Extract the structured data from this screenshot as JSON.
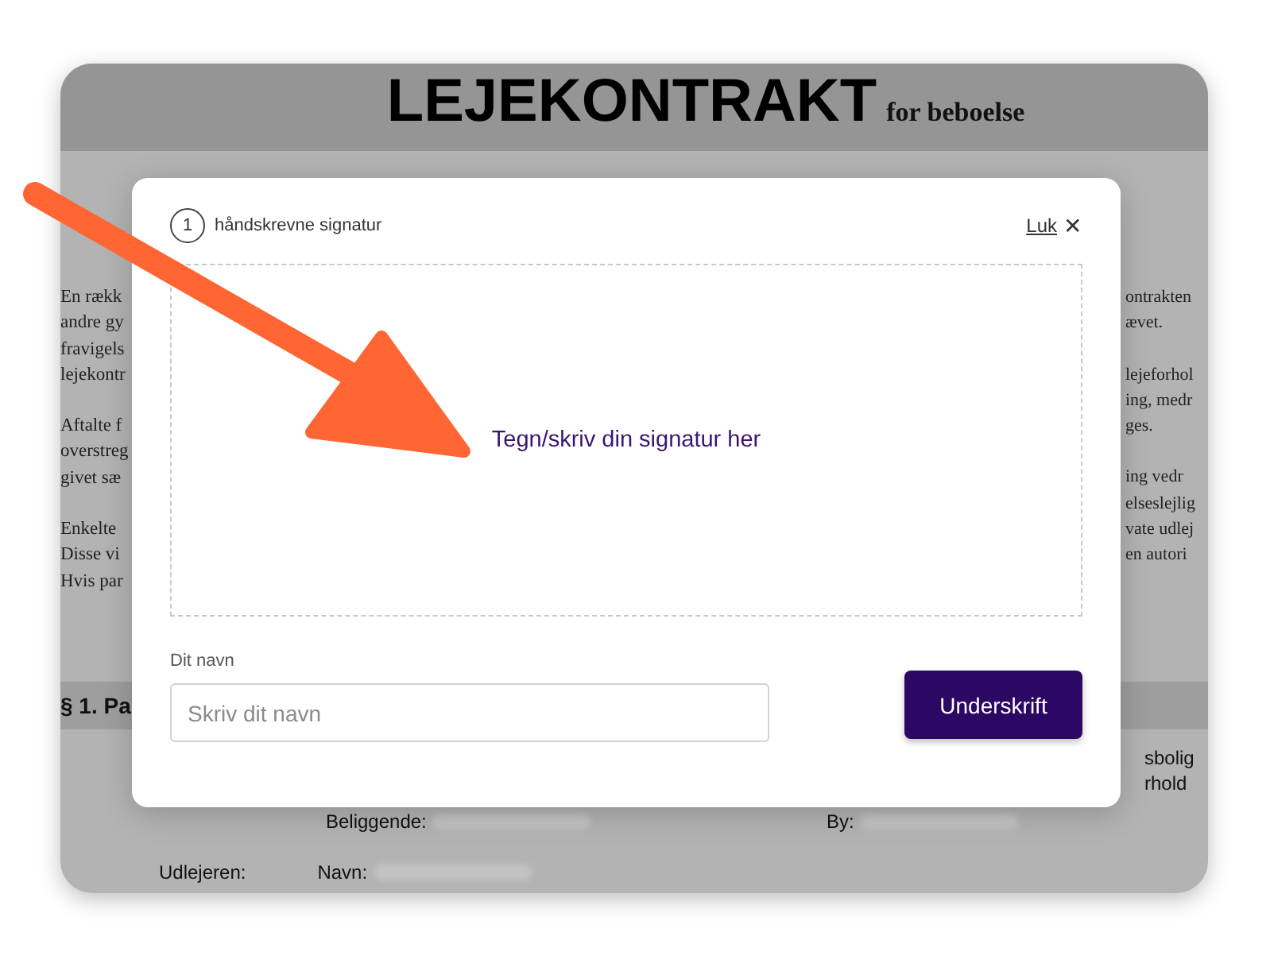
{
  "document": {
    "title": "LEJEKONTRAKT",
    "subtitle": "for beboelse",
    "left_column": [
      [
        "En rækk",
        "andre gy",
        "fravigels",
        "lejekontr"
      ],
      [
        "Aftalte f",
        "overstreg",
        "givet sæ"
      ],
      [
        "Enkelte",
        "Disse vi",
        "Hvis par"
      ]
    ],
    "right_column": [
      [
        "ontrakten",
        "ævet."
      ],
      [
        "lejeforhol",
        "ing, medr",
        "ges."
      ],
      [
        "ing vedr",
        "elseslejlig",
        "vate udlej",
        "en autori"
      ]
    ],
    "section_heading": "§ 1. Pa",
    "section_right": [
      "sbolig",
      "rhold"
    ],
    "property_fields": [
      {
        "label": "Beliggende:"
      },
      {
        "label": "By:"
      }
    ],
    "landlord_label": "Udlejeren:",
    "landlord_fields": [
      {
        "label": "Navn:"
      }
    ]
  },
  "dialog": {
    "step": "1",
    "title": "håndskrevne signatur",
    "close_label": "Luk",
    "close_icon": "✕",
    "signature_prompt": "Tegn/skriv din signatur her",
    "name_label": "Dit navn",
    "name_placeholder": "Skriv dit navn",
    "submit": "Underskrift"
  }
}
